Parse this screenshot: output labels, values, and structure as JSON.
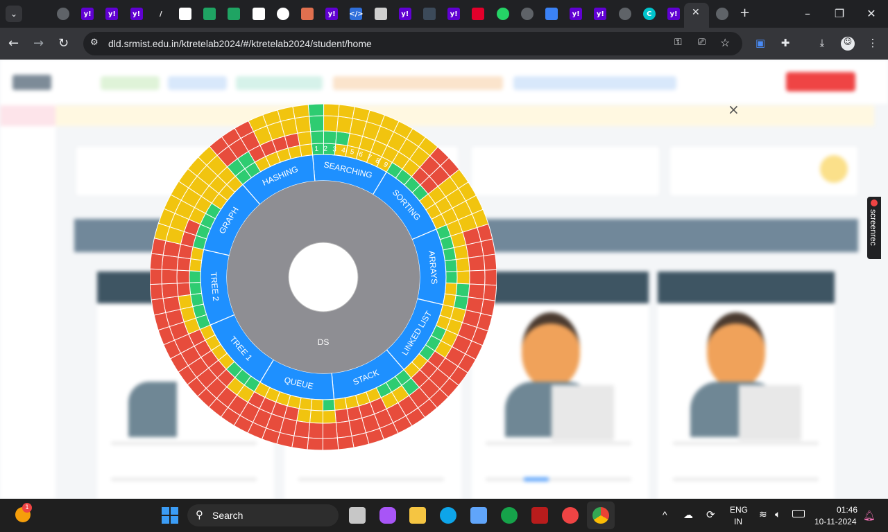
{
  "browser": {
    "url": "dld.srmist.edu.in/ktretelab2024/#/ktretelab2024/student/home",
    "tabs": [
      {
        "icon": "globe-icon",
        "label": "",
        "color": "#5f6368"
      },
      {
        "icon": "yahoo-icon",
        "label": "y!",
        "color": "#6001d2"
      },
      {
        "icon": "yahoo-icon",
        "label": "y!",
        "color": "#6001d2"
      },
      {
        "icon": "yahoo-icon",
        "label": "y!",
        "color": "#6001d2"
      },
      {
        "icon": "pen-icon",
        "label": "/",
        "color": "#202124"
      },
      {
        "icon": "github-icon",
        "label": "",
        "color": "#ffffff"
      },
      {
        "icon": "drive-icon",
        "label": "",
        "color": "#1fa463"
      },
      {
        "icon": "drive-icon",
        "label": "",
        "color": "#1fa463"
      },
      {
        "icon": "github-icon",
        "label": "",
        "color": "#ffffff"
      },
      {
        "icon": "chatgpt-icon",
        "label": "",
        "color": "#ffffff"
      },
      {
        "icon": "turtle-icon",
        "label": "",
        "color": "#e0704f"
      },
      {
        "icon": "yahoo-icon",
        "label": "y!",
        "color": "#6001d2"
      },
      {
        "icon": "code-icon",
        "label": "</>",
        "color": "#2f6fdb"
      },
      {
        "icon": "search-icon",
        "label": "",
        "color": "#cfcfcf"
      },
      {
        "icon": "yahoo-icon",
        "label": "y!",
        "color": "#6001d2"
      },
      {
        "icon": "keyboard-icon",
        "label": "",
        "color": "#3c4a5a"
      },
      {
        "icon": "yahoo-icon",
        "label": "y!",
        "color": "#6001d2"
      },
      {
        "icon": "vercel-icon",
        "label": "",
        "color": "#e3002b"
      },
      {
        "icon": "whatsapp-icon",
        "label": "",
        "color": "#25d366"
      },
      {
        "icon": "globe-icon",
        "label": "",
        "color": "#5f6368"
      },
      {
        "icon": "image-icon",
        "label": "",
        "color": "#3b82f6"
      },
      {
        "icon": "yahoo-icon",
        "label": "y!",
        "color": "#6001d2"
      },
      {
        "icon": "yahoo-icon",
        "label": "y!",
        "color": "#6001d2"
      },
      {
        "icon": "globe-icon",
        "label": "",
        "color": "#5f6368"
      },
      {
        "icon": "canva-icon",
        "label": "C",
        "color": "#00c4cc"
      },
      {
        "icon": "yahoo-icon",
        "label": "y!",
        "color": "#6001d2"
      }
    ]
  },
  "sunburst": {
    "center_label": "DS",
    "colors": {
      "high": "#e74c3c",
      "mid": "#f1c40f",
      "done": "#2ecc71",
      "topic": "#1e90ff",
      "core": "#8e8e93"
    },
    "topics": [
      {
        "name": "SEARCHING",
        "levels": [
          [
            "done",
            "done",
            "mid",
            "mid",
            "mid",
            "mid",
            "mid"
          ],
          [
            "done",
            "done",
            "done",
            "mid",
            "mid",
            "mid",
            "mid"
          ],
          [
            "done",
            "mid",
            "mid",
            "mid",
            "mid",
            "mid",
            "mid"
          ]
        ]
      },
      {
        "name": "SORTING",
        "levels": [
          [
            "done",
            "done",
            "done",
            "done",
            "mid",
            "mid",
            "mid"
          ],
          [
            "mid",
            "mid",
            "high",
            "high",
            "mid",
            "mid",
            "mid"
          ],
          [
            "mid",
            "mid",
            "high",
            "high",
            "mid",
            "mid",
            "mid"
          ]
        ]
      },
      {
        "name": "ARRAYS",
        "levels": [
          [
            "done",
            "done",
            "done",
            "done",
            "done",
            "mid",
            "mid"
          ],
          [
            "mid",
            "mid",
            "mid",
            "mid",
            "mid",
            "done",
            "done"
          ],
          [
            "mid",
            "high",
            "high",
            "high",
            "high",
            "high",
            "high"
          ]
        ]
      },
      {
        "name": "LINKED LIST",
        "levels": [
          [
            "mid",
            "mid",
            "done",
            "done",
            "done",
            "mid",
            "mid"
          ],
          [
            "mid",
            "mid",
            "mid",
            "mid",
            "high",
            "high",
            "high"
          ],
          [
            "high",
            "high",
            "high",
            "high",
            "high",
            "high",
            "high"
          ]
        ]
      },
      {
        "name": "STACK",
        "levels": [
          [
            "done",
            "done",
            "done",
            "mid",
            "mid",
            "mid",
            "mid"
          ],
          [
            "done",
            "mid",
            "mid",
            "high",
            "high",
            "high",
            "high"
          ],
          [
            "high",
            "high",
            "high",
            "high",
            "high",
            "high",
            "high"
          ]
        ]
      },
      {
        "name": "QUEUE",
        "levels": [
          [
            "done",
            "mid",
            "mid",
            "mid",
            "mid",
            "mid",
            "mid"
          ],
          [
            "mid",
            "mid",
            "mid",
            "high",
            "high",
            "high",
            "high"
          ],
          [
            "high",
            "high",
            "high",
            "high",
            "high",
            "high",
            "high"
          ]
        ]
      },
      {
        "name": "TREE 1",
        "levels": [
          [
            "done",
            "done",
            "done",
            "mid",
            "mid",
            "mid",
            "mid"
          ],
          [
            "mid",
            "mid",
            "high",
            "high",
            "high",
            "high",
            "high"
          ],
          [
            "high",
            "high",
            "high",
            "high",
            "high",
            "high",
            "high"
          ]
        ]
      },
      {
        "name": "TREE 2",
        "levels": [
          [
            "done",
            "done",
            "done",
            "done",
            "done",
            "mid",
            "mid"
          ],
          [
            "mid",
            "mid",
            "mid",
            "high",
            "high",
            "high",
            "high"
          ],
          [
            "high",
            "high",
            "high",
            "high",
            "high",
            "high",
            "high"
          ]
        ]
      },
      {
        "name": "GRAPH",
        "levels": [
          [
            "done",
            "done",
            "done",
            "done",
            "mid",
            "mid",
            "mid"
          ],
          [
            "high",
            "high",
            "mid",
            "mid",
            "mid",
            "mid",
            "mid"
          ],
          [
            "mid",
            "mid",
            "mid",
            "mid",
            "mid",
            "mid",
            "mid"
          ]
        ]
      },
      {
        "name": "HASHING",
        "levels": [
          [
            "done",
            "done",
            "mid",
            "mid",
            "mid",
            "mid",
            "mid"
          ],
          [
            "done",
            "done",
            "high",
            "high",
            "high",
            "high",
            "mid"
          ],
          [
            "high",
            "high",
            "high",
            "mid",
            "mid",
            "mid",
            "mid"
          ]
        ]
      }
    ],
    "searching_labels": [
      "1",
      "2",
      "3",
      "4",
      "5",
      "6",
      "7",
      "8",
      "9"
    ]
  },
  "overlay": {
    "close_label": "×"
  },
  "screenrec": {
    "label": "screenrec"
  },
  "taskbar": {
    "search_label": "Search",
    "notification_count": "1",
    "lang_line1": "ENG",
    "lang_line2": "IN",
    "time": "01:46",
    "date": "10-11-2024"
  }
}
